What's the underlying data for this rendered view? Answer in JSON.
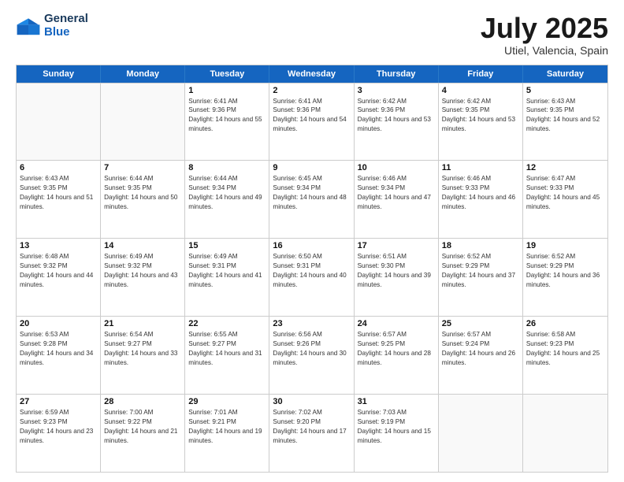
{
  "header": {
    "logo_line1": "General",
    "logo_line2": "Blue",
    "month": "July 2025",
    "location": "Utiel, Valencia, Spain"
  },
  "weekdays": [
    "Sunday",
    "Monday",
    "Tuesday",
    "Wednesday",
    "Thursday",
    "Friday",
    "Saturday"
  ],
  "weeks": [
    [
      {
        "day": "",
        "sunrise": "",
        "sunset": "",
        "daylight": ""
      },
      {
        "day": "",
        "sunrise": "",
        "sunset": "",
        "daylight": ""
      },
      {
        "day": "1",
        "sunrise": "Sunrise: 6:41 AM",
        "sunset": "Sunset: 9:36 PM",
        "daylight": "Daylight: 14 hours and 55 minutes."
      },
      {
        "day": "2",
        "sunrise": "Sunrise: 6:41 AM",
        "sunset": "Sunset: 9:36 PM",
        "daylight": "Daylight: 14 hours and 54 minutes."
      },
      {
        "day": "3",
        "sunrise": "Sunrise: 6:42 AM",
        "sunset": "Sunset: 9:36 PM",
        "daylight": "Daylight: 14 hours and 53 minutes."
      },
      {
        "day": "4",
        "sunrise": "Sunrise: 6:42 AM",
        "sunset": "Sunset: 9:35 PM",
        "daylight": "Daylight: 14 hours and 53 minutes."
      },
      {
        "day": "5",
        "sunrise": "Sunrise: 6:43 AM",
        "sunset": "Sunset: 9:35 PM",
        "daylight": "Daylight: 14 hours and 52 minutes."
      }
    ],
    [
      {
        "day": "6",
        "sunrise": "Sunrise: 6:43 AM",
        "sunset": "Sunset: 9:35 PM",
        "daylight": "Daylight: 14 hours and 51 minutes."
      },
      {
        "day": "7",
        "sunrise": "Sunrise: 6:44 AM",
        "sunset": "Sunset: 9:35 PM",
        "daylight": "Daylight: 14 hours and 50 minutes."
      },
      {
        "day": "8",
        "sunrise": "Sunrise: 6:44 AM",
        "sunset": "Sunset: 9:34 PM",
        "daylight": "Daylight: 14 hours and 49 minutes."
      },
      {
        "day": "9",
        "sunrise": "Sunrise: 6:45 AM",
        "sunset": "Sunset: 9:34 PM",
        "daylight": "Daylight: 14 hours and 48 minutes."
      },
      {
        "day": "10",
        "sunrise": "Sunrise: 6:46 AM",
        "sunset": "Sunset: 9:34 PM",
        "daylight": "Daylight: 14 hours and 47 minutes."
      },
      {
        "day": "11",
        "sunrise": "Sunrise: 6:46 AM",
        "sunset": "Sunset: 9:33 PM",
        "daylight": "Daylight: 14 hours and 46 minutes."
      },
      {
        "day": "12",
        "sunrise": "Sunrise: 6:47 AM",
        "sunset": "Sunset: 9:33 PM",
        "daylight": "Daylight: 14 hours and 45 minutes."
      }
    ],
    [
      {
        "day": "13",
        "sunrise": "Sunrise: 6:48 AM",
        "sunset": "Sunset: 9:32 PM",
        "daylight": "Daylight: 14 hours and 44 minutes."
      },
      {
        "day": "14",
        "sunrise": "Sunrise: 6:49 AM",
        "sunset": "Sunset: 9:32 PM",
        "daylight": "Daylight: 14 hours and 43 minutes."
      },
      {
        "day": "15",
        "sunrise": "Sunrise: 6:49 AM",
        "sunset": "Sunset: 9:31 PM",
        "daylight": "Daylight: 14 hours and 41 minutes."
      },
      {
        "day": "16",
        "sunrise": "Sunrise: 6:50 AM",
        "sunset": "Sunset: 9:31 PM",
        "daylight": "Daylight: 14 hours and 40 minutes."
      },
      {
        "day": "17",
        "sunrise": "Sunrise: 6:51 AM",
        "sunset": "Sunset: 9:30 PM",
        "daylight": "Daylight: 14 hours and 39 minutes."
      },
      {
        "day": "18",
        "sunrise": "Sunrise: 6:52 AM",
        "sunset": "Sunset: 9:29 PM",
        "daylight": "Daylight: 14 hours and 37 minutes."
      },
      {
        "day": "19",
        "sunrise": "Sunrise: 6:52 AM",
        "sunset": "Sunset: 9:29 PM",
        "daylight": "Daylight: 14 hours and 36 minutes."
      }
    ],
    [
      {
        "day": "20",
        "sunrise": "Sunrise: 6:53 AM",
        "sunset": "Sunset: 9:28 PM",
        "daylight": "Daylight: 14 hours and 34 minutes."
      },
      {
        "day": "21",
        "sunrise": "Sunrise: 6:54 AM",
        "sunset": "Sunset: 9:27 PM",
        "daylight": "Daylight: 14 hours and 33 minutes."
      },
      {
        "day": "22",
        "sunrise": "Sunrise: 6:55 AM",
        "sunset": "Sunset: 9:27 PM",
        "daylight": "Daylight: 14 hours and 31 minutes."
      },
      {
        "day": "23",
        "sunrise": "Sunrise: 6:56 AM",
        "sunset": "Sunset: 9:26 PM",
        "daylight": "Daylight: 14 hours and 30 minutes."
      },
      {
        "day": "24",
        "sunrise": "Sunrise: 6:57 AM",
        "sunset": "Sunset: 9:25 PM",
        "daylight": "Daylight: 14 hours and 28 minutes."
      },
      {
        "day": "25",
        "sunrise": "Sunrise: 6:57 AM",
        "sunset": "Sunset: 9:24 PM",
        "daylight": "Daylight: 14 hours and 26 minutes."
      },
      {
        "day": "26",
        "sunrise": "Sunrise: 6:58 AM",
        "sunset": "Sunset: 9:23 PM",
        "daylight": "Daylight: 14 hours and 25 minutes."
      }
    ],
    [
      {
        "day": "27",
        "sunrise": "Sunrise: 6:59 AM",
        "sunset": "Sunset: 9:23 PM",
        "daylight": "Daylight: 14 hours and 23 minutes."
      },
      {
        "day": "28",
        "sunrise": "Sunrise: 7:00 AM",
        "sunset": "Sunset: 9:22 PM",
        "daylight": "Daylight: 14 hours and 21 minutes."
      },
      {
        "day": "29",
        "sunrise": "Sunrise: 7:01 AM",
        "sunset": "Sunset: 9:21 PM",
        "daylight": "Daylight: 14 hours and 19 minutes."
      },
      {
        "day": "30",
        "sunrise": "Sunrise: 7:02 AM",
        "sunset": "Sunset: 9:20 PM",
        "daylight": "Daylight: 14 hours and 17 minutes."
      },
      {
        "day": "31",
        "sunrise": "Sunrise: 7:03 AM",
        "sunset": "Sunset: 9:19 PM",
        "daylight": "Daylight: 14 hours and 15 minutes."
      },
      {
        "day": "",
        "sunrise": "",
        "sunset": "",
        "daylight": ""
      },
      {
        "day": "",
        "sunrise": "",
        "sunset": "",
        "daylight": ""
      }
    ]
  ]
}
